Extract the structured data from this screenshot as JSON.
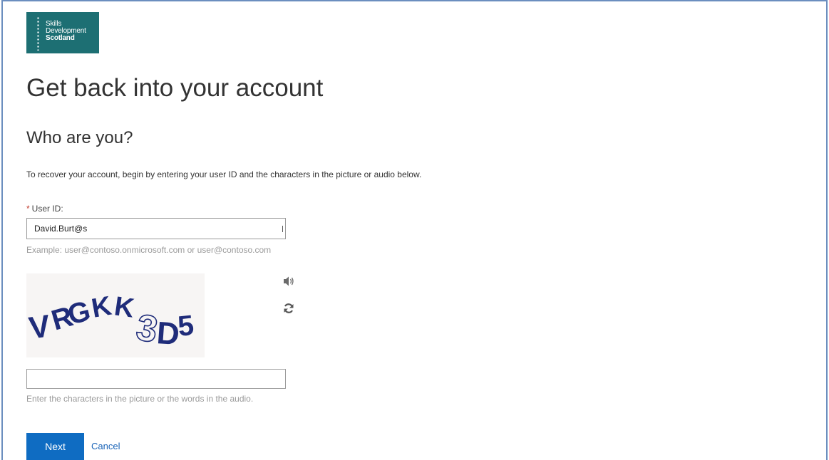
{
  "logo": {
    "line1": "Skills",
    "line2": "Development",
    "line3": "Scotland"
  },
  "page": {
    "title": "Get back into your account",
    "subtitle": "Who are you?",
    "description": "To recover your account, begin by entering your user ID and the characters in the picture or audio below."
  },
  "userid": {
    "required_marker": "*",
    "label": "User ID:",
    "value": "David.Burt@s",
    "example": "Example: user@contoso.onmicrosoft.com or user@contoso.com"
  },
  "captcha": {
    "characters": "VRGKK3D5",
    "audio_icon": "speaker-icon",
    "refresh_icon": "refresh-icon",
    "input_value": "",
    "hint": "Enter the characters in the picture or the words in the audio."
  },
  "actions": {
    "next_label": "Next",
    "cancel_label": "Cancel"
  },
  "colors": {
    "brand": "#1d6f73",
    "primary_button": "#0f6cc2",
    "link": "#1a64b8",
    "required": "#c0392b",
    "captcha_text": "#1f2c7a"
  }
}
